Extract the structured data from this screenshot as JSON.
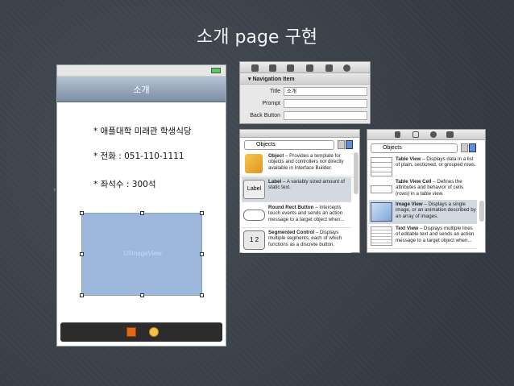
{
  "slide": {
    "title": "소개 page 구현"
  },
  "phone": {
    "nav_title": "소개",
    "info": [
      "* 애플대학 미래관 학생식당",
      "* 전화 : 051-110-1111",
      "* 좌석수 : 300석"
    ],
    "image_view_label": "UIImageView"
  },
  "inspector": {
    "section": "Navigation Item",
    "fields": [
      {
        "label": "Title",
        "value": "소개"
      },
      {
        "label": "Prompt",
        "value": ""
      },
      {
        "label": "Back Button",
        "value": ""
      }
    ]
  },
  "library_left": {
    "selector": "Objects",
    "items": [
      {
        "name": "Object",
        "desc": " – Provides a template for objects and controllers not directly available in Interface Builder.",
        "icon": "cube-icon"
      },
      {
        "name": "Label",
        "desc": " – A variably sized amount of static text.",
        "icon": "label-icon",
        "icon_text": "Label"
      },
      {
        "name": "Round Rect Button",
        "desc": " – Intercepts touch events and sends an action message to a target object when...",
        "icon": "round-rect-button-icon"
      },
      {
        "name": "Segmented Control",
        "desc": " – Displays multiple segments, each of which functions as a discrete button.",
        "icon": "segmented-control-icon",
        "icon_text": "1 2"
      }
    ]
  },
  "library_right": {
    "selector": "Objects",
    "items": [
      {
        "name": "Table View",
        "desc": " – Displays data in a list of plain, sectioned, or grouped rows.",
        "icon": "table-view-icon"
      },
      {
        "name": "Table View Cell",
        "desc": " – Defines the attributes and behavior of cells (rows) in a table view.",
        "icon": "table-view-cell-icon"
      },
      {
        "name": "Image View",
        "desc": " – Displays a single image, or an animation described by an array of images.",
        "icon": "image-view-icon"
      },
      {
        "name": "Text View",
        "desc": " – Displays multiple lines of editable text and sends an action message to a target object when...",
        "icon": "text-view-icon"
      }
    ]
  },
  "colors": {
    "background": "#3b4149",
    "nav_bar": "#7b8ea6",
    "image_view": "#9db7dd",
    "selection": "#d3d9e1"
  }
}
